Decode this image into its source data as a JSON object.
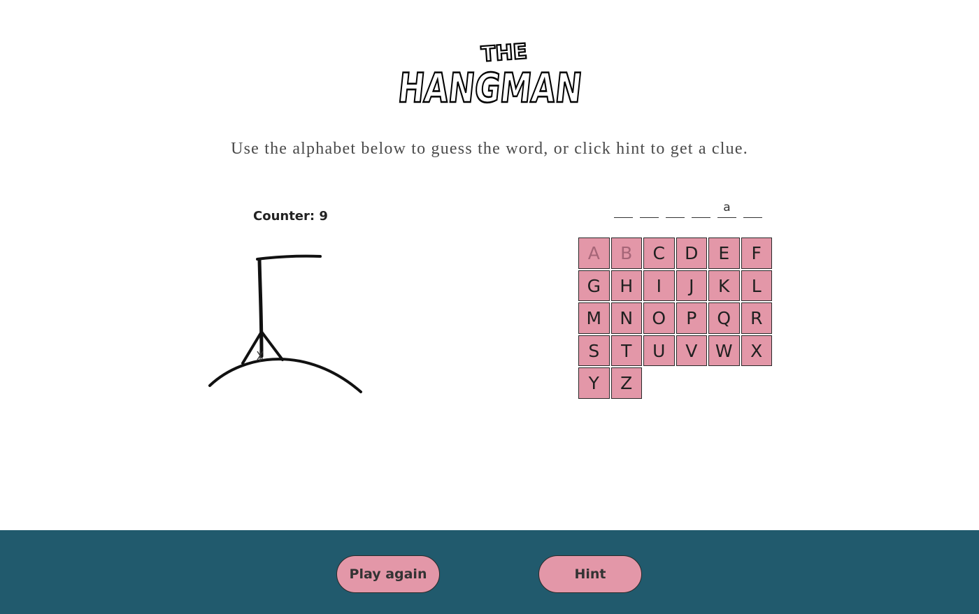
{
  "logo": {
    "small_text": "THE",
    "big_text": "HANGMAN"
  },
  "instructions": "Use the alphabet below to guess the word, or click hint to get a clue.",
  "counter": {
    "text": "Counter: 9"
  },
  "word": {
    "slots": [
      "",
      "",
      "",
      "",
      "a",
      ""
    ]
  },
  "keyboard": {
    "letters": [
      "A",
      "B",
      "C",
      "D",
      "E",
      "F",
      "G",
      "H",
      "I",
      "J",
      "K",
      "L",
      "M",
      "N",
      "O",
      "P",
      "Q",
      "R",
      "S",
      "T",
      "U",
      "V",
      "W",
      "X",
      "Y",
      "Z"
    ],
    "used": [
      "A",
      "B"
    ]
  },
  "buttons": {
    "play_again": "Play again",
    "hint": "Hint"
  },
  "colors": {
    "key_bg": "#e397a8",
    "footer_bg": "#215a6d",
    "used_letter": "#a56577"
  }
}
